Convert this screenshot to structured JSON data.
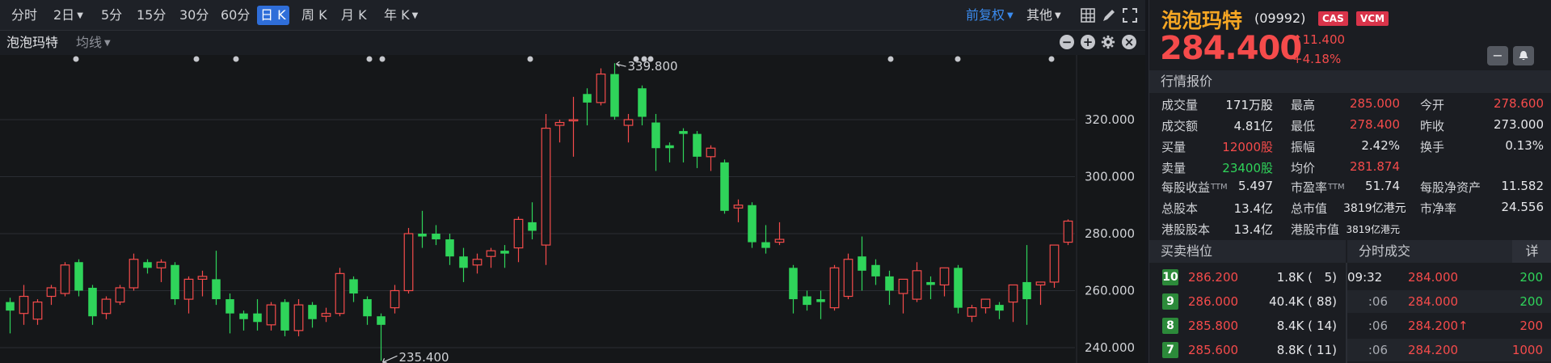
{
  "toolbar": {
    "periods": [
      {
        "label": "分时",
        "caret": false
      },
      {
        "label": "2日",
        "caret": true
      },
      {
        "label": "5分",
        "caret": false
      },
      {
        "label": "15分",
        "caret": false
      },
      {
        "label": "30分",
        "caret": false
      },
      {
        "label": "60分",
        "caret": false
      },
      {
        "label": "日 K",
        "caret": false,
        "active": true
      },
      {
        "label": "周 K",
        "caret": false
      },
      {
        "label": "月 K",
        "caret": false
      },
      {
        "label": "年 K",
        "caret": true
      }
    ],
    "adjust": "前复权",
    "other": "其他"
  },
  "subbar": {
    "stock_name": "泡泡玛特",
    "indicator": "均线"
  },
  "chart_data": {
    "type": "candlestick",
    "y_ticks": [
      "320.000",
      "300.000",
      "280.000",
      "260.000",
      "240.000"
    ],
    "ylim": [
      234.0,
      341.0
    ],
    "max_label": "339.800",
    "min_label": "235.400",
    "candles": [
      {
        "o": 256.0,
        "h": 257.5,
        "l": 245.0,
        "c": 253.0
      },
      {
        "o": 252.0,
        "h": 262.0,
        "l": 248.0,
        "c": 258.0
      },
      {
        "o": 250.0,
        "h": 257.0,
        "l": 248.0,
        "c": 256.0
      },
      {
        "o": 258.0,
        "h": 262.0,
        "l": 255.0,
        "c": 261.0
      },
      {
        "o": 259.0,
        "h": 270.0,
        "l": 258.0,
        "c": 269.0
      },
      {
        "o": 270.0,
        "h": 271.0,
        "l": 258.0,
        "c": 260.0
      },
      {
        "o": 261.0,
        "h": 262.0,
        "l": 248.0,
        "c": 251.0
      },
      {
        "o": 252.0,
        "h": 258.0,
        "l": 250.0,
        "c": 257.0
      },
      {
        "o": 256.0,
        "h": 262.0,
        "l": 255.0,
        "c": 261.0
      },
      {
        "o": 261.0,
        "h": 273.0,
        "l": 260.0,
        "c": 271.0
      },
      {
        "o": 270.0,
        "h": 271.0,
        "l": 266.0,
        "c": 268.0
      },
      {
        "o": 268.0,
        "h": 271.0,
        "l": 263.0,
        "c": 270.0
      },
      {
        "o": 269.0,
        "h": 270.0,
        "l": 255.0,
        "c": 257.0
      },
      {
        "o": 257.0,
        "h": 265.0,
        "l": 252.0,
        "c": 264.0
      },
      {
        "o": 264.0,
        "h": 267.0,
        "l": 258.0,
        "c": 265.0
      },
      {
        "o": 264.0,
        "h": 274.0,
        "l": 255.0,
        "c": 257.0
      },
      {
        "o": 257.0,
        "h": 259.0,
        "l": 245.0,
        "c": 252.0
      },
      {
        "o": 252.0,
        "h": 253.0,
        "l": 246.0,
        "c": 250.0
      },
      {
        "o": 252.0,
        "h": 257.0,
        "l": 246.0,
        "c": 249.0
      },
      {
        "o": 248.0,
        "h": 256.0,
        "l": 246.0,
        "c": 255.0
      },
      {
        "o": 256.0,
        "h": 257.0,
        "l": 244.0,
        "c": 246.0
      },
      {
        "o": 246.0,
        "h": 257.0,
        "l": 244.0,
        "c": 255.0
      },
      {
        "o": 255.0,
        "h": 256.0,
        "l": 247.0,
        "c": 250.0
      },
      {
        "o": 251.0,
        "h": 254.0,
        "l": 249.0,
        "c": 252.0
      },
      {
        "o": 252.0,
        "h": 268.0,
        "l": 251.0,
        "c": 266.0
      },
      {
        "o": 264.0,
        "h": 265.0,
        "l": 256.0,
        "c": 259.0
      },
      {
        "o": 257.0,
        "h": 258.0,
        "l": 248.0,
        "c": 251.0
      },
      {
        "o": 251.0,
        "h": 252.0,
        "l": 235.4,
        "c": 248.0
      },
      {
        "o": 254.0,
        "h": 262.0,
        "l": 252.0,
        "c": 260.0
      },
      {
        "o": 260.0,
        "h": 282.0,
        "l": 259.0,
        "c": 280.0
      },
      {
        "o": 280.0,
        "h": 288.0,
        "l": 275.0,
        "c": 279.0
      },
      {
        "o": 280.0,
        "h": 283.0,
        "l": 276.0,
        "c": 278.0
      },
      {
        "o": 278.0,
        "h": 280.0,
        "l": 269.0,
        "c": 272.0
      },
      {
        "o": 272.0,
        "h": 275.0,
        "l": 263.0,
        "c": 268.0
      },
      {
        "o": 269.0,
        "h": 273.0,
        "l": 266.0,
        "c": 271.0
      },
      {
        "o": 272.0,
        "h": 275.0,
        "l": 268.0,
        "c": 274.0
      },
      {
        "o": 274.0,
        "h": 276.0,
        "l": 268.0,
        "c": 273.0
      },
      {
        "o": 275.0,
        "h": 286.0,
        "l": 270.0,
        "c": 285.0
      },
      {
        "o": 284.0,
        "h": 291.0,
        "l": 278.0,
        "c": 281.0
      },
      {
        "o": 276.0,
        "h": 322.0,
        "l": 269.0,
        "c": 317.0
      },
      {
        "o": 318.0,
        "h": 320.0,
        "l": 312.0,
        "c": 319.0
      },
      {
        "o": 320.0,
        "h": 328.0,
        "l": 307.0,
        "c": 320.0
      },
      {
        "o": 329.0,
        "h": 331.0,
        "l": 318.0,
        "c": 326.0
      },
      {
        "o": 326.0,
        "h": 338.0,
        "l": 325.0,
        "c": 336.0
      },
      {
        "o": 336.0,
        "h": 339.8,
        "l": 320.0,
        "c": 321.0
      },
      {
        "o": 318.0,
        "h": 322.0,
        "l": 312.0,
        "c": 320.0
      },
      {
        "o": 331.0,
        "h": 332.0,
        "l": 318.0,
        "c": 321.0
      },
      {
        "o": 319.0,
        "h": 322.0,
        "l": 302.0,
        "c": 310.0
      },
      {
        "o": 311.0,
        "h": 312.0,
        "l": 305.0,
        "c": 310.0
      },
      {
        "o": 316.0,
        "h": 317.0,
        "l": 305.0,
        "c": 315.0
      },
      {
        "o": 315.0,
        "h": 316.0,
        "l": 303.0,
        "c": 307.0
      },
      {
        "o": 307.0,
        "h": 311.0,
        "l": 302.0,
        "c": 310.0
      },
      {
        "o": 305.0,
        "h": 306.0,
        "l": 287.0,
        "c": 288.0
      },
      {
        "o": 289.0,
        "h": 292.0,
        "l": 284.0,
        "c": 290.0
      },
      {
        "o": 290.0,
        "h": 291.0,
        "l": 275.0,
        "c": 277.0
      },
      {
        "o": 277.0,
        "h": 283.0,
        "l": 273.0,
        "c": 275.0
      },
      {
        "o": 277.0,
        "h": 284.0,
        "l": 276.0,
        "c": 278.0
      },
      {
        "o": 268.0,
        "h": 269.0,
        "l": 252.0,
        "c": 257.0
      },
      {
        "o": 258.0,
        "h": 260.0,
        "l": 253.0,
        "c": 255.0
      },
      {
        "o": 257.0,
        "h": 260.0,
        "l": 250.0,
        "c": 256.0
      },
      {
        "o": 254.0,
        "h": 269.0,
        "l": 253.0,
        "c": 268.0
      },
      {
        "o": 258.0,
        "h": 273.0,
        "l": 257.0,
        "c": 271.0
      },
      {
        "o": 272.0,
        "h": 279.0,
        "l": 260.0,
        "c": 267.0
      },
      {
        "o": 269.0,
        "h": 271.0,
        "l": 262.0,
        "c": 265.0
      },
      {
        "o": 265.0,
        "h": 267.0,
        "l": 255.0,
        "c": 260.0
      },
      {
        "o": 259.0,
        "h": 263.0,
        "l": 252.0,
        "c": 264.0
      },
      {
        "o": 257.0,
        "h": 270.0,
        "l": 256.0,
        "c": 267.0
      },
      {
        "o": 263.0,
        "h": 265.0,
        "l": 257.0,
        "c": 262.0
      },
      {
        "o": 262.0,
        "h": 268.0,
        "l": 258.0,
        "c": 268.0
      },
      {
        "o": 268.0,
        "h": 269.0,
        "l": 252.0,
        "c": 254.0
      },
      {
        "o": 251.0,
        "h": 255.0,
        "l": 249.0,
        "c": 254.0
      },
      {
        "o": 254.0,
        "h": 257.0,
        "l": 252.0,
        "c": 257.0
      },
      {
        "o": 255.0,
        "h": 256.0,
        "l": 250.0,
        "c": 253.0
      },
      {
        "o": 256.0,
        "h": 260.0,
        "l": 249.0,
        "c": 262.0
      },
      {
        "o": 263.0,
        "h": 276.0,
        "l": 248.0,
        "c": 257.0
      },
      {
        "o": 262.0,
        "h": 263.0,
        "l": 255.0,
        "c": 263.0
      },
      {
        "o": 263.0,
        "h": 275.0,
        "l": 261.0,
        "c": 276.0
      },
      {
        "o": 277.0,
        "h": 285.0,
        "l": 276.0,
        "c": 284.4
      }
    ]
  },
  "quote": {
    "name": "泡泡玛特",
    "code": "(09992)",
    "tags": [
      "CAS",
      "VCM"
    ],
    "price": "284.400",
    "change": "11.400",
    "change_pct": "+4.18%",
    "section_title": "行情报价",
    "rows": [
      {
        "l1": "成交量",
        "v1": "171万股",
        "c1": "white",
        "l2": "最高",
        "v2": "285.000",
        "c2": "red",
        "l3": "今开",
        "v3": "278.600",
        "c3": "red"
      },
      {
        "l1": "成交额",
        "v1": "4.81亿",
        "c1": "white",
        "l2": "最低",
        "v2": "278.400",
        "c2": "red",
        "l3": "昨收",
        "v3": "273.000",
        "c3": "white"
      },
      {
        "l1": "买量",
        "v1": "12000股",
        "c1": "red",
        "l2": "振幅",
        "v2": "2.42%",
        "c2": "white",
        "l3": "换手",
        "v3": "0.13%",
        "c3": "white"
      },
      {
        "l1": "卖量",
        "v1": "23400股",
        "c1": "green",
        "l2": "均价",
        "v2": "281.874",
        "c2": "red",
        "l3": "",
        "v3": "",
        "c3": "white"
      }
    ],
    "rows2": [
      {
        "l1": "每股收益",
        "t1": "TTM",
        "v1": "5.497",
        "l2": "市盈率",
        "t2": "TTM",
        "v2": "51.74",
        "l3": "每股净资产",
        "v3": "11.582"
      },
      {
        "l1": "总股本",
        "t1": "",
        "v1": "13.4亿",
        "l2": "总市值",
        "t2": "",
        "v2": "3819亿港元",
        "l3": "市净率",
        "v3": "24.556"
      },
      {
        "l1": "港股股本",
        "t1": "",
        "v1": "13.4亿",
        "l2": "港股市值",
        "t2": "",
        "v2": "3819亿港元",
        "l3": "",
        "v3": ""
      }
    ]
  },
  "orderbook": {
    "title": "买卖档位",
    "levels": [
      {
        "level": "10",
        "price": "286.200",
        "volume": "1.8K (",
        "count": "5)"
      },
      {
        "level": "9",
        "price": "286.000",
        "volume": "40.4K (",
        "count": "88)"
      },
      {
        "level": "8",
        "price": "285.800",
        "volume": "8.4K (",
        "count": "14)"
      },
      {
        "level": "7",
        "price": "285.600",
        "volume": "8.8K (",
        "count": "11)"
      }
    ]
  },
  "trades": {
    "title": "分时成交",
    "detail": "详",
    "rows": [
      {
        "time": "09:32",
        "price": "284.000",
        "arrow": "",
        "vol": "200",
        "color": "green"
      },
      {
        "time": ":06",
        "price": "284.000",
        "arrow": "",
        "vol": "200",
        "color": "green"
      },
      {
        "time": ":06",
        "price": "284.200",
        "arrow": "↑",
        "vol": "200",
        "color": "red"
      },
      {
        "time": ":06",
        "price": "284.200",
        "arrow": "",
        "vol": "1000",
        "color": "red"
      }
    ]
  },
  "colors": {
    "up": "#f54b4b",
    "down": "#2fd45a",
    "accent": "#2f6ed9",
    "brand": "#f5a623"
  }
}
